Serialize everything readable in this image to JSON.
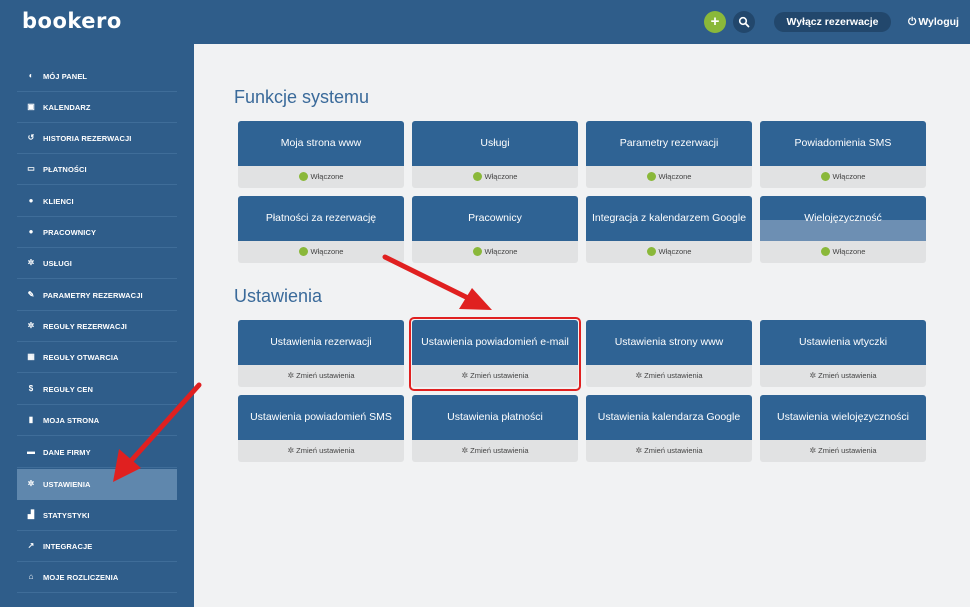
{
  "app": {
    "logo": "bookero"
  },
  "topbar": {
    "add_icon": "plus-icon",
    "search_icon": "search-icon",
    "toggle_label": "Wyłącz rezerwacje",
    "logout_label": "Wyloguj"
  },
  "sidebar": {
    "items": [
      {
        "label": "MÓJ PANEL",
        "icon": "dashboard-icon"
      },
      {
        "label": "KALENDARZ",
        "icon": "calendar-icon"
      },
      {
        "label": "HISTORIA REZERWACJI",
        "icon": "history-icon"
      },
      {
        "label": "PŁATNOŚCI",
        "icon": "credit-card-icon"
      },
      {
        "label": "KLIENCI",
        "icon": "users-icon"
      },
      {
        "label": "PRACOWNICY",
        "icon": "user-plus-icon"
      },
      {
        "label": "USŁUGI",
        "icon": "cogs-icon"
      },
      {
        "label": "PARAMETRY REZERWACJI",
        "icon": "wrench-icon"
      },
      {
        "label": "REGUŁY REZERWACJI",
        "icon": "gear-icon"
      },
      {
        "label": "REGUŁY OTWARCIA",
        "icon": "calendar-grid-icon"
      },
      {
        "label": "REGUŁY CEN",
        "icon": "dollar-icon"
      },
      {
        "label": "MOJA STRONA",
        "icon": "file-icon"
      },
      {
        "label": "DANE FIRMY",
        "icon": "briefcase-icon"
      },
      {
        "label": "USTAWIENIA",
        "icon": "gear-icon",
        "active": true
      },
      {
        "label": "STATYSTYKI",
        "icon": "chart-icon"
      },
      {
        "label": "INTEGRACJE",
        "icon": "external-link-icon"
      },
      {
        "label": "MOJE ROZLICZENIA",
        "icon": "bank-icon"
      }
    ]
  },
  "functions": {
    "title": "Funkcje systemu",
    "status_label": "Włączone",
    "cards": [
      {
        "title": "Moja strona www"
      },
      {
        "title": "Usługi"
      },
      {
        "title": "Parametry rezerwacji"
      },
      {
        "title": "Powiadomienia SMS"
      },
      {
        "title": "Płatności za rezerwację"
      },
      {
        "title": "Pracownicy"
      },
      {
        "title": "Integracja z kalendarzem Google"
      },
      {
        "title": "Wielojęzyczność"
      }
    ]
  },
  "settings": {
    "title": "Ustawienia",
    "action_label": "Zmień ustawienia",
    "cards": [
      {
        "title": "Ustawienia rezerwacji"
      },
      {
        "title": "Ustawienia powiadomień e-mail"
      },
      {
        "title": "Ustawienia strony www"
      },
      {
        "title": "Ustawienia wtyczki"
      },
      {
        "title": "Ustawienia powiadomień SMS"
      },
      {
        "title": "Ustawienia płatności"
      },
      {
        "title": "Ustawienia kalendarza Google"
      },
      {
        "title": "Ustawienia wielojęzyczności"
      }
    ]
  },
  "annotations": {
    "arrow_color": "#e02020",
    "highlight_color": "#e02020"
  },
  "colors": {
    "brand": "#2f5d8a",
    "card_head": "#2f6394",
    "active_nav": "#5f87ad",
    "status_green": "#8ab83a"
  }
}
